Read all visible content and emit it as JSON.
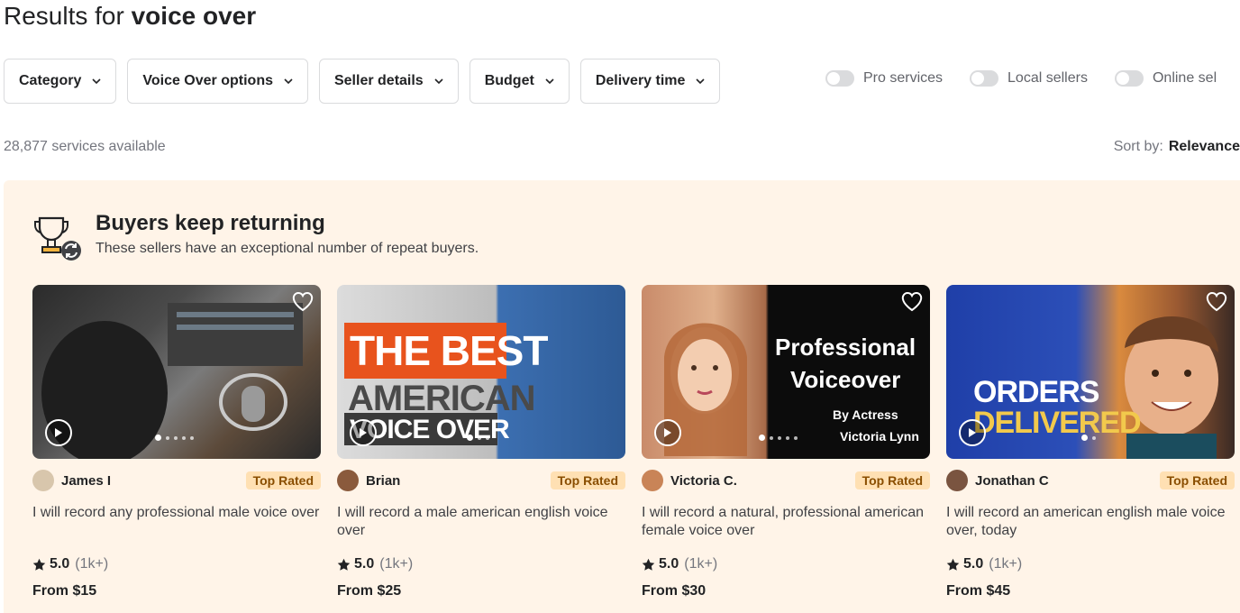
{
  "header": {
    "title_prefix": "Results for",
    "title_term": "voice over"
  },
  "filters": [
    {
      "label": "Category"
    },
    {
      "label": "Voice Over options"
    },
    {
      "label": "Seller details"
    },
    {
      "label": "Budget"
    },
    {
      "label": "Delivery time"
    }
  ],
  "toggles": [
    {
      "label": "Pro services",
      "on": false
    },
    {
      "label": "Local sellers",
      "on": false
    },
    {
      "label": "Online sel",
      "on": false
    }
  ],
  "results": {
    "count": "28,877 services available",
    "sort_label": "Sort by:",
    "sort_value": "Relevance"
  },
  "promo": {
    "title": "Buyers keep returning",
    "subtitle": "These sellers have an exceptional number of repeat buyers.",
    "icon": "trophy-repeat-icon",
    "bg_color": "#fff4e8"
  },
  "cards": [
    {
      "seller": "James I",
      "badge": "Top Rated",
      "title": "I will record any professional male voice over",
      "score": "5.0",
      "reviews": "(1k+)",
      "price": "From $15",
      "thumb_text": []
    },
    {
      "seller": "Brian",
      "badge": "Top Rated",
      "title": "I will record a male american english voice over",
      "score": "5.0",
      "reviews": "(1k+)",
      "price": "From $25",
      "thumb_text": [
        "THE BEST",
        "AMERICAN",
        "VOICE OVER"
      ]
    },
    {
      "seller": "Victoria C.",
      "badge": "Top Rated",
      "title": "I will record a natural, professional american female voice over",
      "score": "5.0",
      "reviews": "(1k+)",
      "price": "From $30",
      "thumb_text": [
        "Professional",
        "Voiceover",
        "By Actress",
        "Victoria Lynn"
      ]
    },
    {
      "seller": "Jonathan C",
      "badge": "Top Rated",
      "title": "I will record an american english male voice over, today",
      "score": "5.0",
      "reviews": "(1k+)",
      "price": "From $45",
      "thumb_text": [
        "ORDERS",
        "DELIVERED"
      ]
    }
  ],
  "colors": {
    "badge_bg": "#ffe0b3",
    "badge_text": "#8a4e00",
    "accent_orange": "#e8531d"
  }
}
